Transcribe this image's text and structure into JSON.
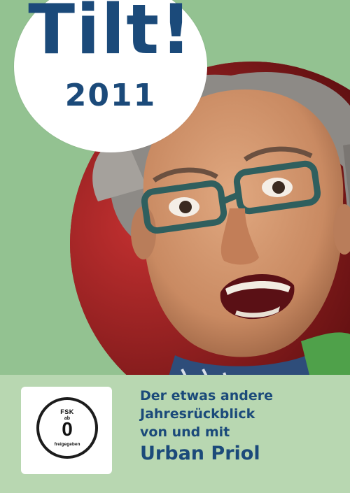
{
  "cover": {
    "title": "Tilt!",
    "year": "2011",
    "colors": {
      "background_green": "#93c291",
      "band_green": "#b8d7b1",
      "title_blue": "#1b4a7a",
      "photo_red": "#8e1c1c"
    }
  },
  "rating": {
    "label": "FSK",
    "prefix": "ab",
    "age": "0",
    "note": "freigegeben"
  },
  "tagline": {
    "line1": "Der etwas andere",
    "line2": "Jahresrückblick",
    "line3": "von und mit",
    "name": "Urban Priol"
  },
  "photo": {
    "subject": "man-with-glasses-icon"
  }
}
